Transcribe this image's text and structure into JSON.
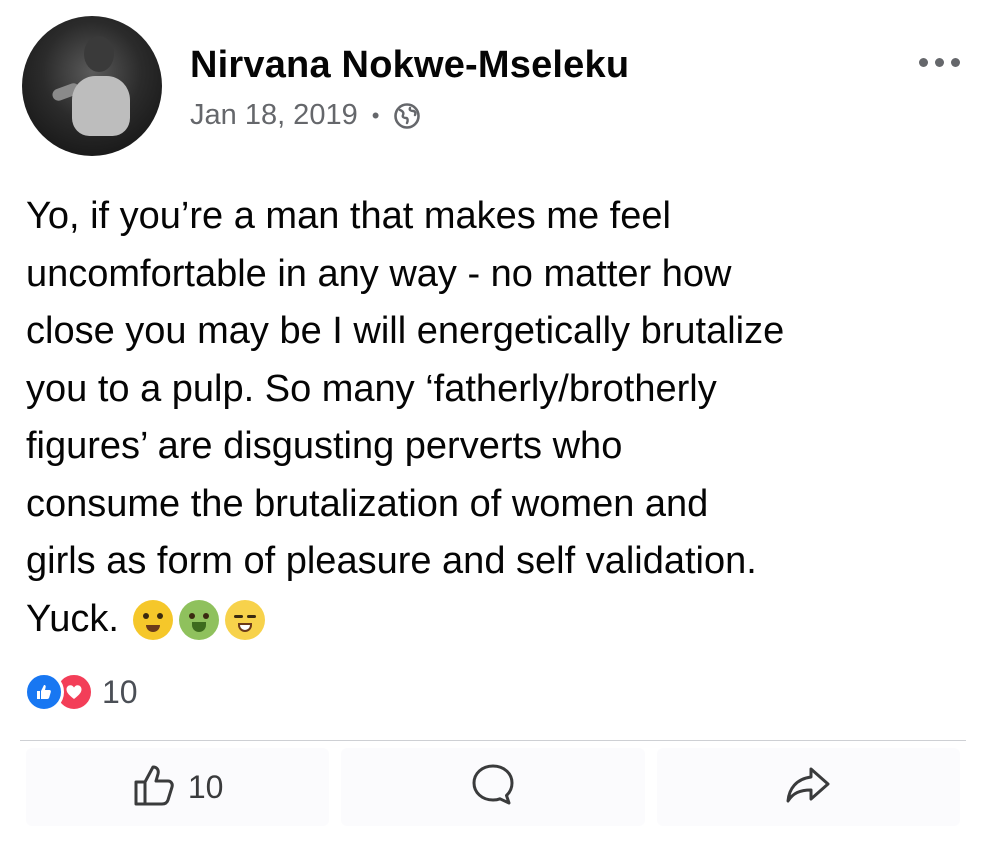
{
  "post": {
    "author": "Nirvana Nokwe-Mseleku",
    "date": "Jan 18, 2019",
    "separator": "•",
    "privacy_icon": "globe-icon",
    "more_icon": "more-options-icon",
    "body_lines": [
      "Yo, if you’re a man that makes me feel",
      "uncomfortable in any way - no matter how",
      "close you may be I will energetically brutalize",
      "you to a pulp. So many ‘fatherly/brotherly",
      "figures’ are disgusting perverts who",
      "consume the brutalization of women and",
      "girls as form of pleasure and self validation.",
      "Yuck."
    ],
    "emojis": [
      "woozy-face-emoji",
      "nauseated-face-emoji",
      "tired-face-emoji"
    ]
  },
  "reactions": {
    "icons": [
      "like-reaction-icon",
      "love-reaction-icon"
    ],
    "count": "10"
  },
  "actions": {
    "like_count": "10"
  },
  "colors": {
    "like_blue": "#1877f2",
    "love_red": "#f33e58",
    "secondary_text": "#65676b"
  }
}
